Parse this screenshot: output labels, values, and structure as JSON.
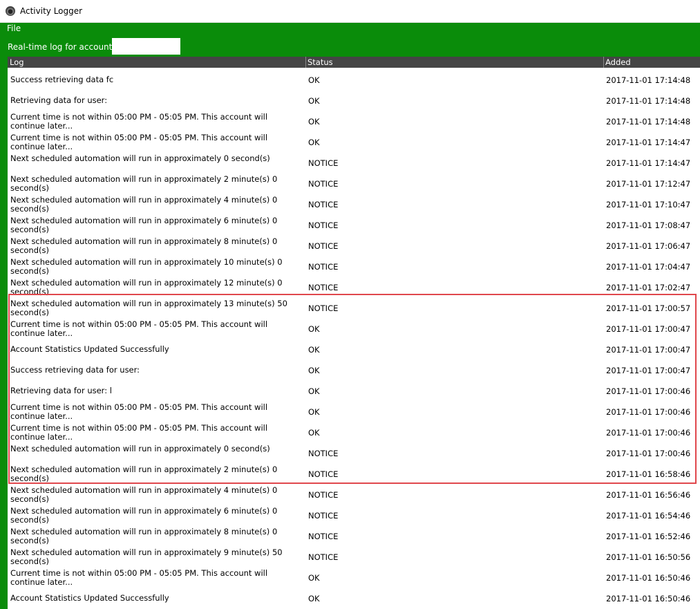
{
  "window": {
    "title": "Activity Logger",
    "icon": "app-icon"
  },
  "menu": {
    "file": "File"
  },
  "account": {
    "label": "Real-time log for account:",
    "value": ""
  },
  "table": {
    "headers": {
      "log": "Log",
      "status": "Status",
      "added": "Added"
    },
    "rows": [
      {
        "log": "Success retrieving data fс",
        "status": "OK",
        "added": "2017-11-01 17:14:48"
      },
      {
        "log": "Retrieving data for user:",
        "status": "OK",
        "added": "2017-11-01 17:14:48"
      },
      {
        "log": "Current time is not within 05:00 PM - 05:05 PM. This account will continue later...",
        "status": "OK",
        "added": "2017-11-01 17:14:48"
      },
      {
        "log": "Current time is not within 05:00 PM - 05:05 PM. This account will continue later...",
        "status": "OK",
        "added": "2017-11-01 17:14:47"
      },
      {
        "log": "Next scheduled automation will run in approximately 0 second(s)",
        "status": "NOTICE",
        "added": "2017-11-01 17:14:47"
      },
      {
        "log": "Next scheduled automation will run in approximately 2 minute(s) 0 second(s)",
        "status": "NOTICE",
        "added": "2017-11-01 17:12:47"
      },
      {
        "log": "Next scheduled automation will run in approximately 4 minute(s) 0 second(s)",
        "status": "NOTICE",
        "added": "2017-11-01 17:10:47"
      },
      {
        "log": "Next scheduled automation will run in approximately 6 minute(s) 0 second(s)",
        "status": "NOTICE",
        "added": "2017-11-01 17:08:47"
      },
      {
        "log": "Next scheduled automation will run in approximately 8 minute(s) 0 second(s)",
        "status": "NOTICE",
        "added": "2017-11-01 17:06:47"
      },
      {
        "log": "Next scheduled automation will run in approximately 10 minute(s) 0 second(s)",
        "status": "NOTICE",
        "added": "2017-11-01 17:04:47"
      },
      {
        "log": "Next scheduled automation will run in approximately 12 minute(s) 0 second(s)",
        "status": "NOTICE",
        "added": "2017-11-01 17:02:47"
      },
      {
        "log": "Next scheduled automation will run in approximately 13 minute(s) 50 second(s)",
        "status": "NOTICE",
        "added": "2017-11-01 17:00:57"
      },
      {
        "log": "Current time is not within 05:00 PM - 05:05 PM. This account will continue later...",
        "status": "OK",
        "added": "2017-11-01 17:00:47"
      },
      {
        "log": "Account Statistics Updated Successfully",
        "status": "OK",
        "added": "2017-11-01 17:00:47"
      },
      {
        "log": "Success retrieving data for user:",
        "status": "OK",
        "added": "2017-11-01 17:00:47"
      },
      {
        "log": "Retrieving data for user: l",
        "status": "OK",
        "added": "2017-11-01 17:00:46"
      },
      {
        "log": "Current time is not within 05:00 PM - 05:05 PM. This account will continue later...",
        "status": "OK",
        "added": "2017-11-01 17:00:46"
      },
      {
        "log": "Current time is not within 05:00 PM - 05:05 PM. This account will continue later...",
        "status": "OK",
        "added": "2017-11-01 17:00:46"
      },
      {
        "log": "Next scheduled automation will run in approximately 0 second(s)",
        "status": "NOTICE",
        "added": "2017-11-01 17:00:46"
      },
      {
        "log": "Next scheduled automation will run in approximately 2 minute(s) 0 second(s)",
        "status": "NOTICE",
        "added": "2017-11-01 16:58:46"
      },
      {
        "log": "Next scheduled automation will run in approximately 4 minute(s) 0 second(s)",
        "status": "NOTICE",
        "added": "2017-11-01 16:56:46"
      },
      {
        "log": "Next scheduled automation will run in approximately 6 minute(s) 0 second(s)",
        "status": "NOTICE",
        "added": "2017-11-01 16:54:46"
      },
      {
        "log": "Next scheduled automation will run in approximately 8 minute(s) 0 second(s)",
        "status": "NOTICE",
        "added": "2017-11-01 16:52:46"
      },
      {
        "log": "Next scheduled automation will run in approximately 9 minute(s) 50 second(s)",
        "status": "NOTICE",
        "added": "2017-11-01 16:50:56"
      },
      {
        "log": "Current time is not within 05:00 PM - 05:05 PM. This account will continue later...",
        "status": "OK",
        "added": "2017-11-01 16:50:46"
      },
      {
        "log": "Account Statistics Updated Successfully",
        "status": "OK",
        "added": "2017-11-01 16:50:46"
      }
    ]
  },
  "colors": {
    "panel": "#0a8c0a",
    "header": "#454545",
    "highlight": "#e0474c"
  }
}
